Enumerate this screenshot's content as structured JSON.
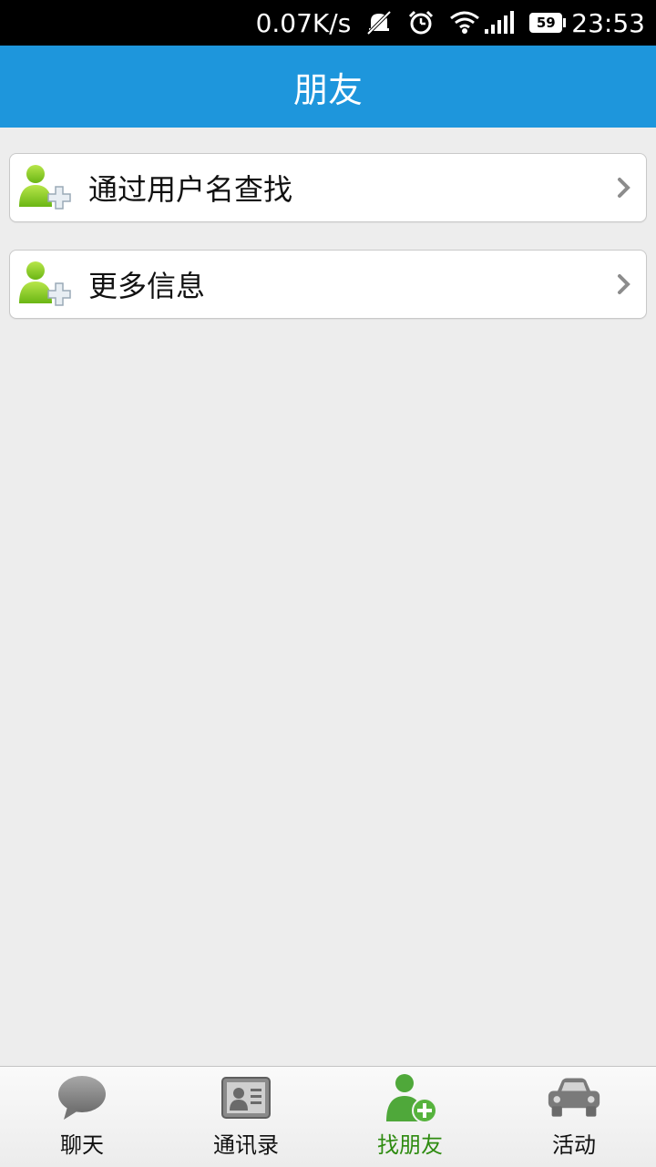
{
  "status_bar": {
    "net_speed": "0.07K/s",
    "battery_level": "59",
    "time": "23:53",
    "icons": [
      "mute-icon",
      "alarm-icon",
      "wifi-icon",
      "signal-icon",
      "battery-icon"
    ]
  },
  "header": {
    "title": "朋友"
  },
  "main": {
    "items": [
      {
        "label": "通过用户名查找",
        "icon": "add-user-icon"
      },
      {
        "label": "更多信息",
        "icon": "add-user-icon"
      }
    ]
  },
  "bottom_nav": {
    "tabs": [
      {
        "label": "聊天",
        "icon": "chat-bubble-icon"
      },
      {
        "label": "通讯录",
        "icon": "contact-card-icon"
      },
      {
        "label": "找朋友",
        "icon": "find-friend-icon",
        "active": true
      },
      {
        "label": "活动",
        "icon": "car-icon"
      }
    ]
  },
  "colors": {
    "header_bg": "#1e96dc",
    "active_tab": "#2e8b10",
    "page_bg": "#ededed"
  }
}
